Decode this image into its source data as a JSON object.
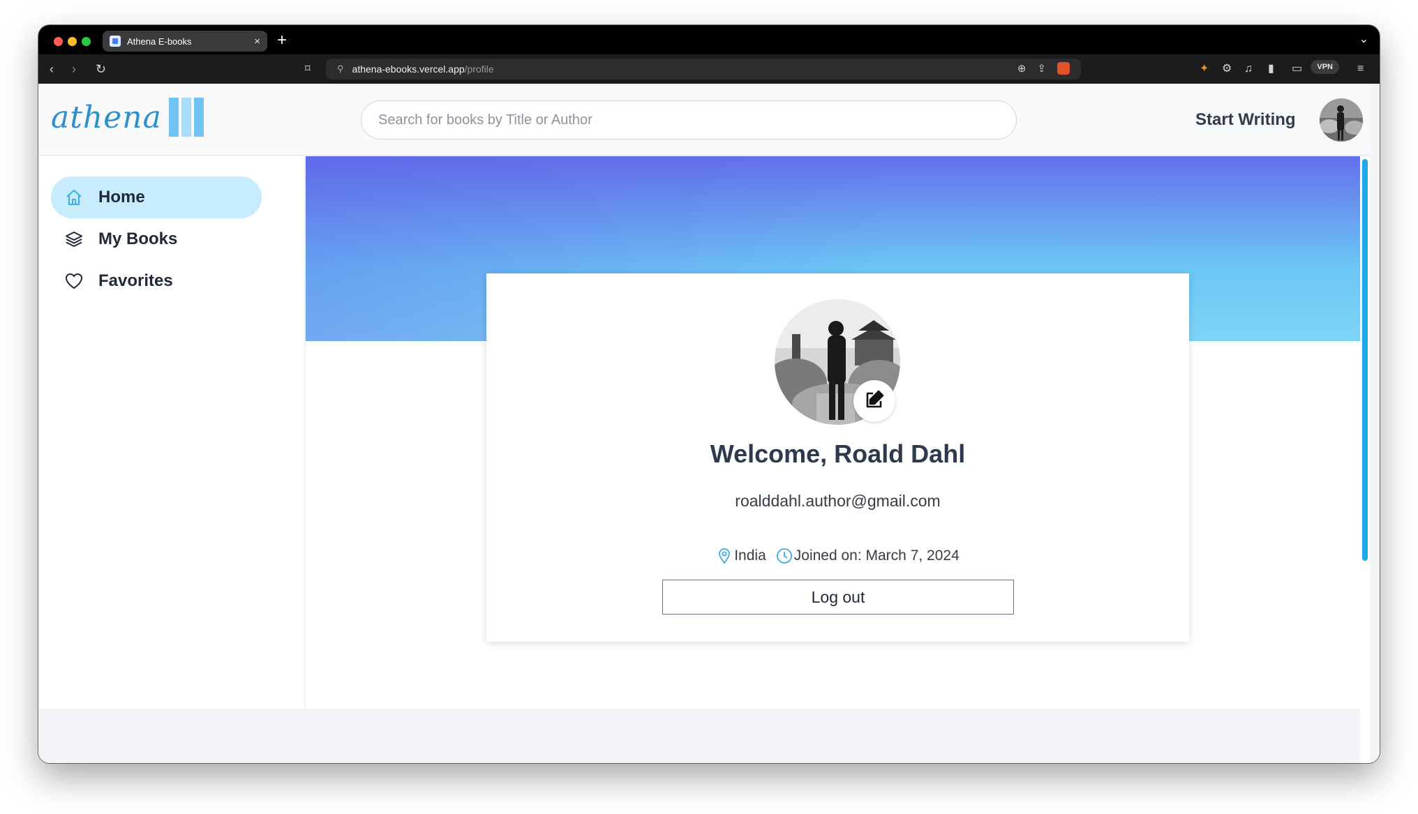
{
  "browser": {
    "tab_title": "Athena E-books",
    "tab_close": "×",
    "new_tab": "+",
    "url_domain": "athena-ebooks.vercel.app",
    "url_path": "/profile",
    "vpn_label": "VPN"
  },
  "header": {
    "logo_text": "athena",
    "search_placeholder": "Search for books by Title or Author",
    "start_writing": "Start Writing"
  },
  "sidebar": {
    "items": [
      {
        "label": "Home",
        "icon": "home-icon",
        "active": true
      },
      {
        "label": "My Books",
        "icon": "layers-icon",
        "active": false
      },
      {
        "label": "Favorites",
        "icon": "heart-icon",
        "active": false
      }
    ]
  },
  "profile": {
    "welcome": "Welcome, Roald Dahl",
    "email": "roalddahl.author@gmail.com",
    "location": "India",
    "joined": "Joined on: March 7, 2024",
    "logout_label": "Log out"
  },
  "colors": {
    "accent": "#2f8fcb",
    "active_nav": "#c7ecfd",
    "banner_start": "#6470ea",
    "banner_end": "#7ed3f7",
    "scrollbar": "#22a8e8"
  }
}
